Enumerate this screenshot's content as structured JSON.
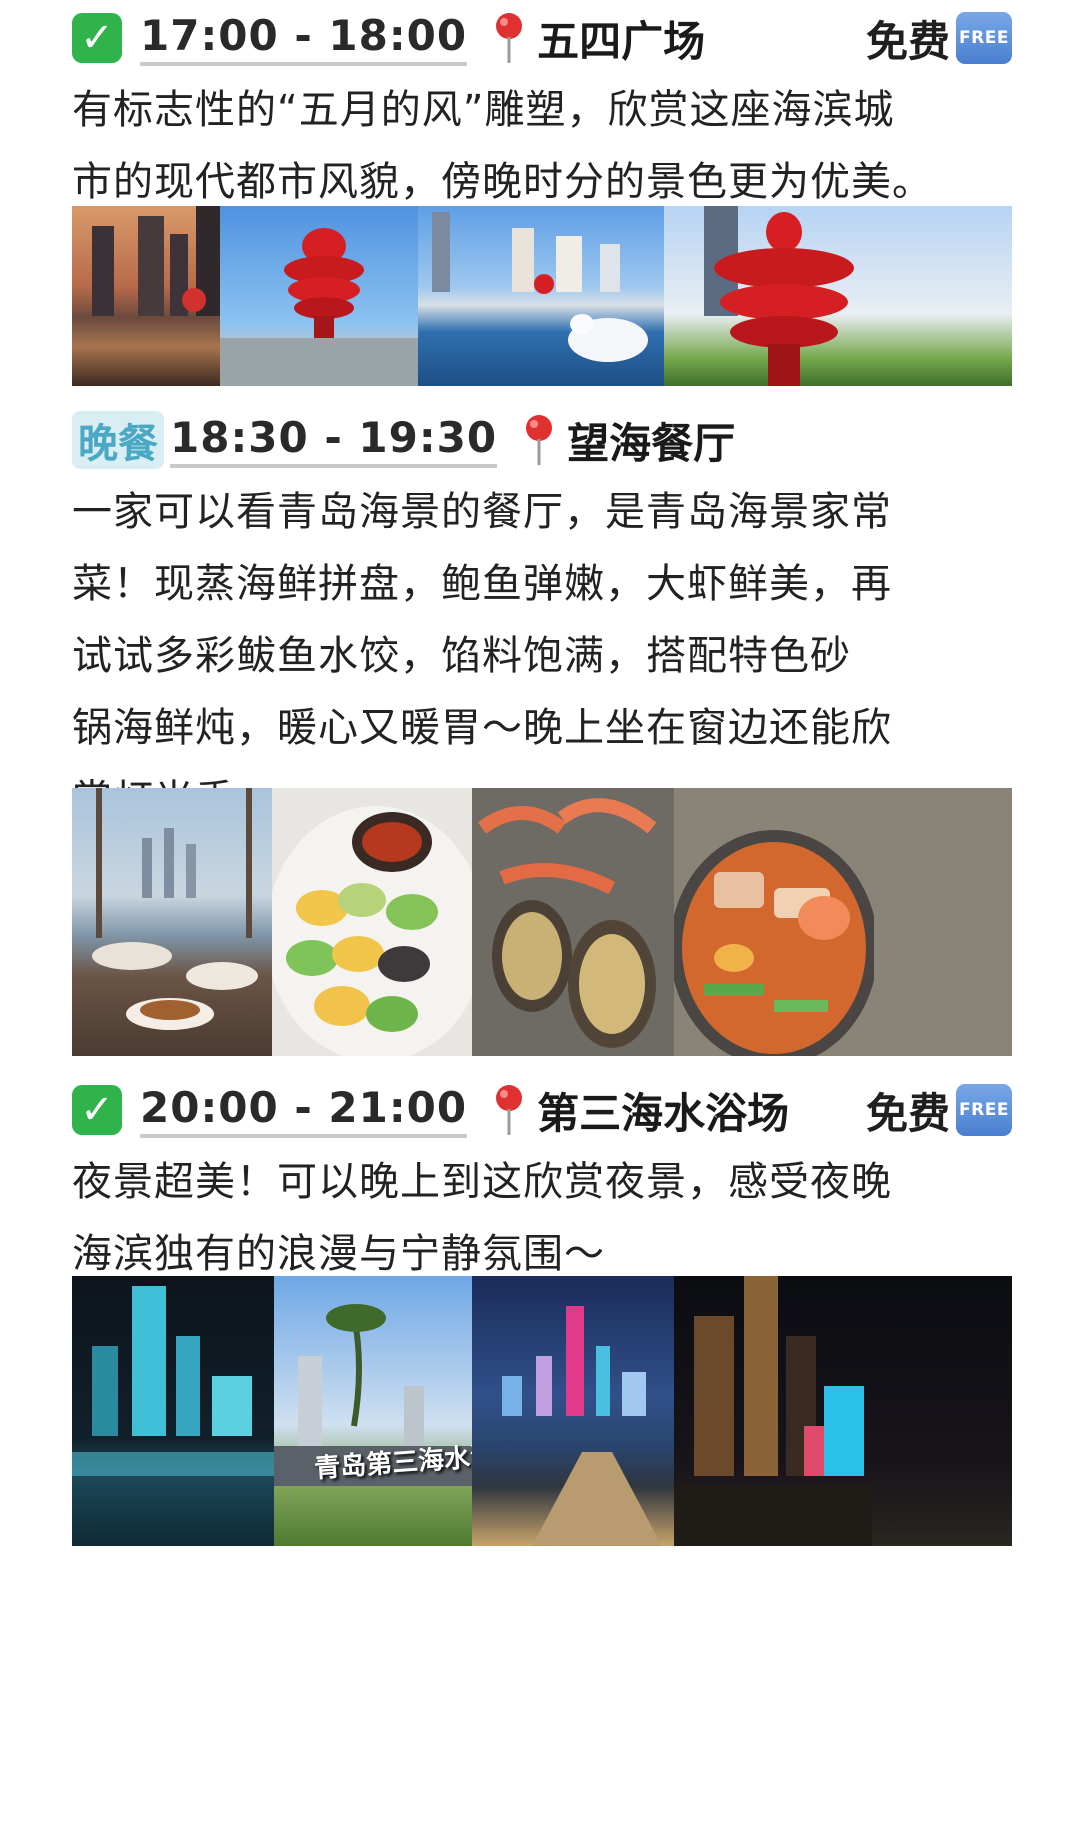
{
  "sections": [
    {
      "time": "17:00 - 18:00",
      "place": "五四广场",
      "fee": "免费",
      "fee_badge": "FREE",
      "desc_lines": [
        "有标志性的“五月的风”雕塑，欣赏这座海滨城",
        "市的现代都市风貌，傍晚时分的景色更为优美。"
      ],
      "photos": [
        "sunset skyline with red sculpture",
        "red spiral sculpture in plaza",
        "waterfront with seagull",
        "red spiral sculpture close-up"
      ]
    },
    {
      "meal_tag": "晚餐",
      "time": "18:30 - 19:30",
      "place": "望海餐厅",
      "desc_lines": [
        "一家可以看青岛海景的餐厅，是青岛海景家常",
        "菜！现蒸海鲜拼盘，鲍鱼弹嫩，大虾鲜美，再",
        "试试多彩鲅鱼水饺，馅料饱满，搭配特色砂",
        "锅海鲜炖，暖心又暖胃～晚上坐在窗边还能欣",
        "赏灯光秀"
      ],
      "photos": [
        "restaurant window sea view",
        "colorful dumplings",
        "steamed seafood platter",
        "casserole seafood stew"
      ]
    },
    {
      "time": "20:00 - 21:00",
      "place": "第三海水浴场",
      "fee": "免费",
      "fee_badge": "FREE",
      "desc_lines": [
        "夜景超美！可以晚上到这欣赏夜景，感受夜晚",
        "海滨独有的浪漫与宁静氛围～"
      ],
      "photos": [
        "night skyline teal lights",
        "beach sign daytime",
        "pink tower night skyline",
        "night city with crowd"
      ],
      "sign_text": "青岛第三海水浴场"
    }
  ],
  "colors": {
    "check": "#2fb34a",
    "meal_tag_bg": "#d8eef3",
    "meal_tag_text": "#4aa8c4",
    "pin": "#e03131",
    "free_badge": "#5b8ed8"
  }
}
